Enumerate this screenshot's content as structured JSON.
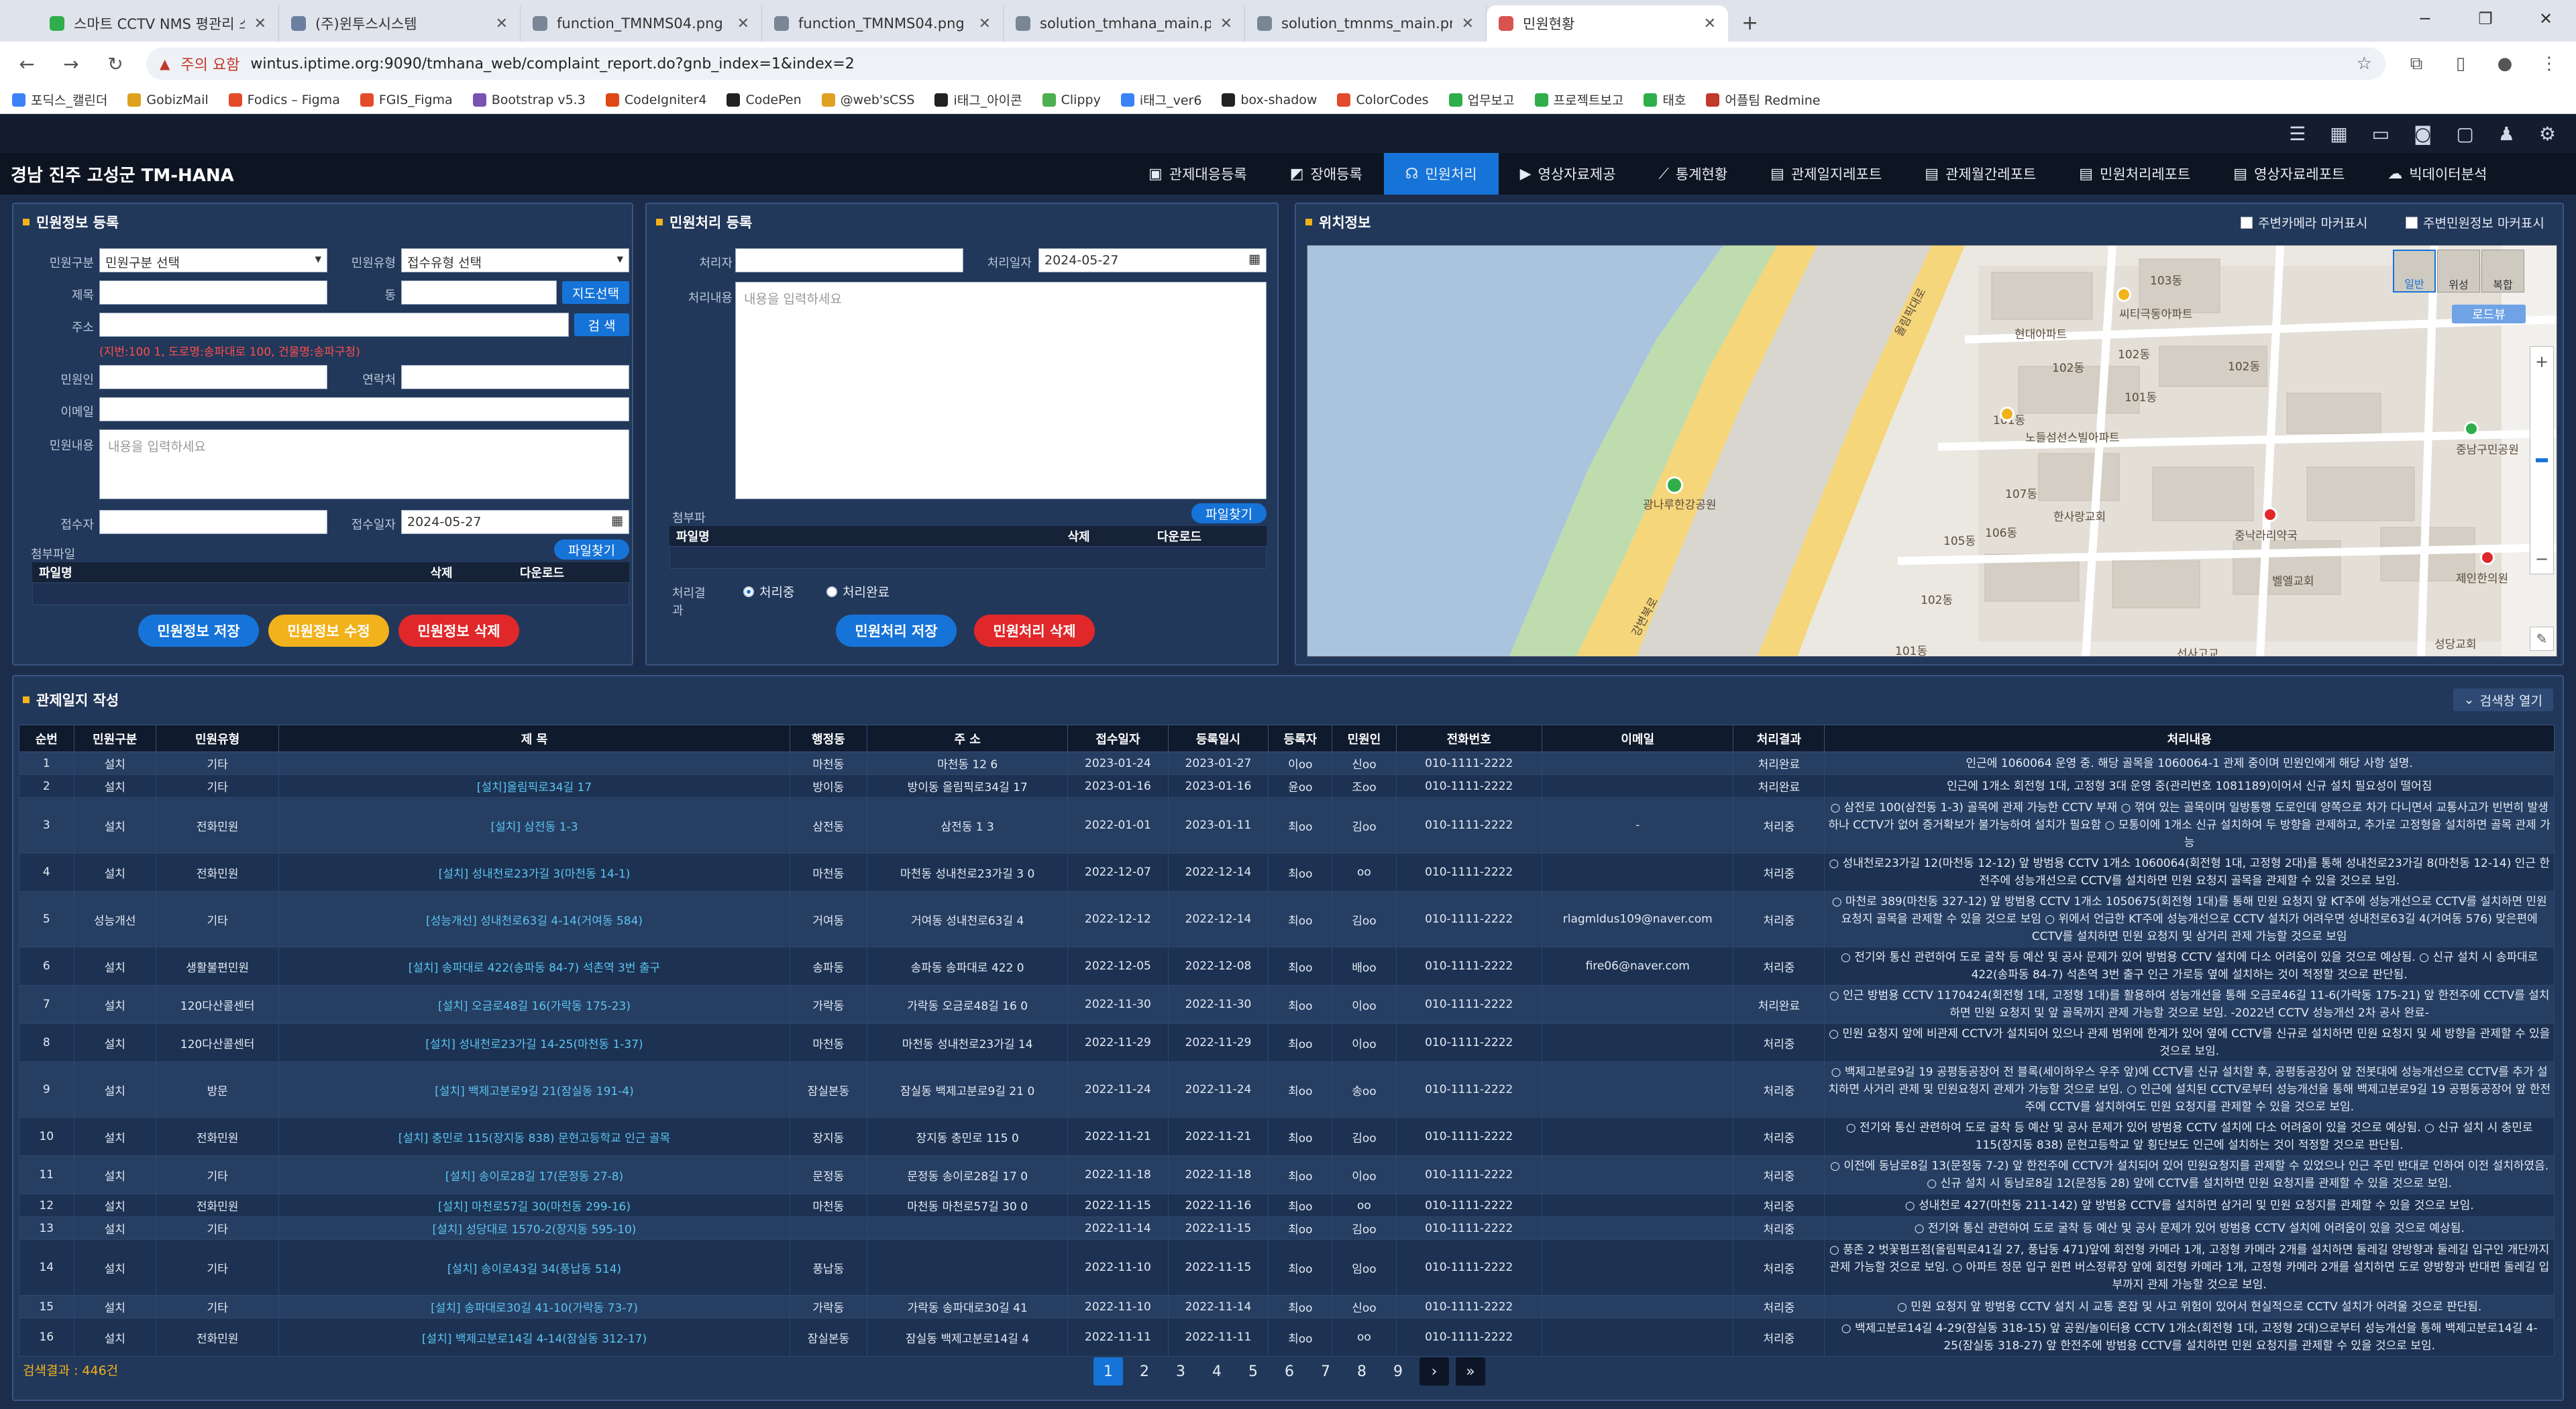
{
  "browser": {
    "tabs": [
      {
        "title": "스마트 CCTV NMS 평관리 소프",
        "color": "#2fae4b"
      },
      {
        "title": "(주)윈투스시스템",
        "color": "#6b7fa0"
      },
      {
        "title": "function_TMNMS04.png (3604",
        "color": "#7a8596"
      },
      {
        "title": "function_TMNMS04.png (3604",
        "color": "#7a8596"
      },
      {
        "title": "solution_tmhana_main.png (7...",
        "color": "#7a8596"
      },
      {
        "title": "solution_tmnms_main.png (72...",
        "color": "#7a8596"
      },
      {
        "title": "민원현황",
        "color": "#d9534f"
      }
    ],
    "security_label": "주의 요함",
    "url": "wintus.iptime.org:9090/tmhana_web/complaint_report.do?gnb_index=1&index=2",
    "bookmarks": [
      {
        "label": "포딕스_캘린더",
        "color": "#3b82f6"
      },
      {
        "label": "GobizMail",
        "color": "#e0a020"
      },
      {
        "label": "Fodics – Figma",
        "color": "#e34b2a"
      },
      {
        "label": "FGIS_Figma",
        "color": "#e34b2a"
      },
      {
        "label": "Bootstrap v5.3",
        "color": "#7952b3"
      },
      {
        "label": "CodeIgniter4",
        "color": "#dd4814"
      },
      {
        "label": "CodePen",
        "color": "#222222"
      },
      {
        "label": "@web'sCSS",
        "color": "#e0a020"
      },
      {
        "label": "i태그_아이콘",
        "color": "#222222"
      },
      {
        "label": "Clippy",
        "color": "#4caf50"
      },
      {
        "label": "i태그_ver6",
        "color": "#3b82f6"
      },
      {
        "label": "box-shadow",
        "color": "#222222"
      },
      {
        "label": "ColorCodes",
        "color": "#e34b2a"
      },
      {
        "label": "업무보고",
        "color": "#2fae4b"
      },
      {
        "label": "프로젝트보고",
        "color": "#2fae4b"
      },
      {
        "label": "태호",
        "color": "#2fae4b"
      },
      {
        "label": "어플팀 Redmine",
        "color": "#c0392b"
      }
    ]
  },
  "app": {
    "title": "경남 진주 고성군 TM-HANA",
    "nav": [
      {
        "label": "관제대응등록",
        "icon": "▣"
      },
      {
        "label": "장애등록",
        "icon": "◩"
      },
      {
        "label": "민원처리",
        "icon": "☊"
      },
      {
        "label": "영상자료제공",
        "icon": "▶"
      },
      {
        "label": "통계현황",
        "icon": "⟋"
      },
      {
        "label": "관제일지레포트",
        "icon": "▤"
      },
      {
        "label": "관제월간레포트",
        "icon": "▤"
      },
      {
        "label": "민원처리레포트",
        "icon": "▤"
      },
      {
        "label": "영상자료레포트",
        "icon": "▤"
      },
      {
        "label": "빅데이터분석",
        "icon": "☁"
      }
    ]
  },
  "complaint_info": {
    "title": "민원정보 등록",
    "type_label": "민원구분",
    "type_value": "민원구분 선택",
    "kind_label": "민원유형",
    "kind_value": "접수유형 선택",
    "subject_label": "제목",
    "dong_label": "동",
    "map_btn": "지도선택",
    "addr_label": "주소",
    "search_btn": "검 색",
    "addr_hint": "(지번:100 1, 도로명:송파대로 100, 건물명:송파구청)",
    "person_label": "민원인",
    "contact_label": "연락처",
    "email_label": "이메일",
    "content_label": "민원내용",
    "content_ph": "내용을 입력하세요",
    "receiver_label": "접수자",
    "date_label": "접수일자",
    "date_value": "2024-05-27",
    "attach_label": "첨부파일",
    "file_btn": "파일찾기",
    "file_cols": [
      "파일명",
      "삭제",
      "다운로드"
    ],
    "save": "민원정보 저장",
    "edit": "민원정보 수정",
    "delete": "민원정보 삭제"
  },
  "complaint_proc": {
    "title": "민원처리 등록",
    "handler_label": "처리자",
    "date_label": "처리일자",
    "date_value": "2024-05-27",
    "content_label": "처리내용",
    "content_ph": "내용을 입력하세요",
    "attach_label": "첨부파일",
    "file_btn": "파일찾기",
    "file_cols": [
      "파일명",
      "삭제",
      "다운로드"
    ],
    "result_label": "처리결과",
    "opt1": "처리중",
    "opt2": "처리완료",
    "save": "민원처리 저장",
    "delete": "민원처리 삭제"
  },
  "location": {
    "title": "위치정보",
    "chk1": "주변카메라 마커표시",
    "chk2": "주변민원정보 마커표시",
    "map_types": [
      "일반",
      "위성",
      "복합"
    ],
    "roadview": "로드뷰",
    "labels": {
      "l1": "올림픽대로",
      "l2": "현대아파트",
      "l3": "씨티극동아파트",
      "l4": "103동",
      "l5": "102동",
      "l6": "101동",
      "l7": "101동",
      "l8": "102동",
      "l9": "102동",
      "l10": "노들섬선스빌아파트",
      "l11": "광나루한강공원",
      "l12": "107동",
      "l13": "106동",
      "l14": "105동",
      "l15": "한사랑교회",
      "l16": "중낙라리약국",
      "l17": "벨엘교회",
      "l18": "제인한의원",
      "l19": "중남구민공원",
      "l20": "102동",
      "l21": "101동",
      "l22": "선사고교",
      "l23": "강변북로",
      "l24": "성당교회"
    }
  },
  "log": {
    "title": "관제일지 작성",
    "search_toggle": "검색창 열기",
    "columns": [
      "순번",
      "민원구분",
      "민원유형",
      "제 목",
      "행정동",
      "주 소",
      "접수일자",
      "등록일시",
      "등록자",
      "민원인",
      "전화번호",
      "이메일",
      "처리결과",
      "처리내용"
    ],
    "rows": [
      [
        "1",
        "설치",
        "기타",
        "",
        "마천동",
        "마천동 12 6",
        "2023-01-24",
        "2023-01-27",
        "이oo",
        "신oo",
        "010-1111-2222",
        "",
        "처리완료",
        "인근에 1060064 운영 중. 해당 골목을 1060064-1 관제 중이며 민원인에게 해당 사항 설명."
      ],
      [
        "2",
        "설치",
        "기타",
        "[설치]올림픽로34길 17",
        "방이동",
        "방이동 올림픽로34길 17",
        "2023-01-16",
        "2023-01-16",
        "윤oo",
        "조oo",
        "010-1111-2222",
        "",
        "처리완료",
        "인근에 1개소 회전형 1대, 고정형 3대 운영 중(관리번호 1081189)이어서 신규 설치 필요성이 떨어짐"
      ],
      [
        "3",
        "설치",
        "전화민원",
        "[설치] 삼전동 1-3",
        "삼전동",
        "삼전동 1 3",
        "2022-01-01",
        "2023-01-11",
        "최oo",
        "김oo",
        "010-1111-2222",
        "-",
        "처리중",
        "○ 삼전로 100(삼전동 1-3) 골목에 관제 가능한 CCTV 부재 ○ 꺾여 있는 골목이며 일방통행 도로인데 양쪽으로 차가 다니면서 교통사고가 빈번히 발생하나 CCTV가 없어 증거확보가 불가능하여 설치가 필요함 ○ 모통이에 1개소 신규 설치하여 두 방향을 관제하고, 추가로 고정형을 설치하면 골목 관제 가능"
      ],
      [
        "4",
        "설치",
        "전화민원",
        "[설치] 성내천로23가길 3(마천동 14-1)",
        "마천동",
        "마천동 성내천로23가길 3 0",
        "2022-12-07",
        "2022-12-14",
        "최oo",
        "oo",
        "010-1111-2222",
        "",
        "처리중",
        "○ 성내천로23가길 12(마천동 12-12) 앞 방범용 CCTV 1개소 1060064(회전형 1대, 고정형 2대)를 통해 성내천로23가길 8(마천동 12-14) 인근 한전주에 성능개선으로 CCTV를 설치하면 민원 요청지 골목을 관제할 수 있을 것으로 보임."
      ],
      [
        "5",
        "성능개선",
        "기타",
        "[성능개선] 성내천로63길 4-14(거여동 584)",
        "거여동",
        "거여동 성내천로63길 4",
        "2022-12-12",
        "2022-12-14",
        "최oo",
        "김oo",
        "010-1111-2222",
        "rlagmldus109@naver.com",
        "처리중",
        "○ 마천로 389(마천동 327-12) 앞 방범용 CCTV 1개소 1050675(회전형 1대)를 통해 민원 요청지 앞 KT주에 성능개선으로 CCTV를 설치하면 민원 요청지 골목을 관제할 수 있을 것으로 보임 ○ 위에서 언급한 KT주에 성능개선으로 CCTV 설치가 어려우면 성내천로63길 4(거여동 576) 맞은편에 CCTV를 설치하면 민원 요청지 및 삼거리 관제 가능할 것으로 보임"
      ],
      [
        "6",
        "설치",
        "생활불편민원",
        "[설치] 송파대로 422(송파동 84-7) 석촌역 3번 출구",
        "송파동",
        "송파동 송파대로 422 0",
        "2022-12-05",
        "2022-12-08",
        "최oo",
        "배oo",
        "010-1111-2222",
        "fire06@naver.com",
        "처리중",
        "○ 전기와 통신 관련하여 도로 굴착 등 예산 및 공사 문제가 있어 방범용 CCTV 설치에 다소 어려움이 있을 것으로 예상됨. ○ 신규 설치 시 송파대로 422(송파동 84-7) 석촌역 3번 출구 인근 가로등 옆에 설치하는 것이 적정할 것으로 판단됨."
      ],
      [
        "7",
        "설치",
        "120다산콜센터",
        "[설치] 오금로48길 16(가락동 175-23)",
        "가락동",
        "가락동 오금로48길 16 0",
        "2022-11-30",
        "2022-11-30",
        "최oo",
        "이oo",
        "010-1111-2222",
        "",
        "처리완료",
        "○ 인근 방범용 CCTV 1170424(회전형 1대, 고정형 1대)를 활용하여 성능개선을 통해 오금로46길 11-6(가락동 175-21) 앞 한전주에 CCTV를 설치하면 민원 요청지 및 앞 골목까지 관제 가능할 것으로 보임. -2022년 CCTV 성능개선 2차 공사 완료-"
      ],
      [
        "8",
        "설치",
        "120다산콜센터",
        "[설치] 성내천로23가길 14-25(마천동 1-37)",
        "마천동",
        "마천동 성내천로23가길 14",
        "2022-11-29",
        "2022-11-29",
        "최oo",
        "이oo",
        "010-1111-2222",
        "",
        "처리중",
        "○ 민원 요청지 앞에 비관제 CCTV가 설치되어 있으나 관제 범위에 한계가 있어 옆에 CCTV를 신규로 설치하면 민원 요청지 및 세 방향을 관제할 수 있을 것으로 보임."
      ],
      [
        "9",
        "설치",
        "방문",
        "[설치] 백제고분로9길 21(잠실동 191-4)",
        "잠실본동",
        "잠실동 백제고분로9길 21 0",
        "2022-11-24",
        "2022-11-24",
        "최oo",
        "송oo",
        "010-1111-2222",
        "",
        "처리중",
        "○ 백제고분로9길 19 공평동공장어 전 블록(세이하우스 우주 앞)에 CCTV를 신규 설치할 후, 공평동공장어 앞 전봇대에 성능개선으로 CCTV를 추가 설치하면 사거리 관제 및 민원요청지 관제가 가능할 것으로 보임. ○ 인근에 설치된 CCTV로부터 성능개선을 통해 백제고분로9길 19 공평동공장어 앞 한전주에 CCTV를 설치하여도 민원 요청지를 관제할 수 있을 것으로 보임."
      ],
      [
        "10",
        "설치",
        "전화민원",
        "[설치] 충민로 115(장지동 838) 문현고등학교 인근 골목",
        "장지동",
        "장지동 충민로 115 0",
        "2022-11-21",
        "2022-11-21",
        "최oo",
        "김oo",
        "010-1111-2222",
        "",
        "처리중",
        "○ 전기와 통신 관련하여 도로 굴착 등 예산 및 공사 문제가 있어 방범용 CCTV 설치에 다소 어려움이 있을 것으로 예상됨. ○ 신규 설치 시 충민로 115(장지동 838) 문현고등학교 앞 횡단보도 인근에 설치하는 것이 적정할 것으로 판단됨."
      ],
      [
        "11",
        "설치",
        "기타",
        "[설치] 송이로28길 17(문정동 27-8)",
        "문정동",
        "문정동 송이로28길 17 0",
        "2022-11-18",
        "2022-11-18",
        "최oo",
        "이oo",
        "010-1111-2222",
        "",
        "처리중",
        "○ 이전에 동남로8길 13(문정동 7-2) 앞 한전주에 CCTV가 설치되어 있어 민원요청지를 관제할 수 있었으나 인근 주민 반대로 인하여 이전 설치하였음. ○ 신규 설치 시 동남로8길 12(문정동 28) 앞에 CCTV를 설치하면 민원 요청지를 관제할 수 있을 것으로 보임."
      ],
      [
        "12",
        "설치",
        "전화민원",
        "[설치] 마천로57길 30(마천동 299-16)",
        "마천동",
        "마천동 마천로57길 30 0",
        "2022-11-15",
        "2022-11-16",
        "최oo",
        "oo",
        "010-1111-2222",
        "",
        "처리중",
        "○ 성내천로 427(마천동 211-142) 앞 방범용 CCTV를 설치하면 삼거리 및 민원 요청지를 관제할 수 있을 것으로 보임."
      ],
      [
        "13",
        "설치",
        "기타",
        "[설치] 성당대로 1570-2(장지동 595-10)",
        "",
        "",
        "2022-11-14",
        "2022-11-15",
        "최oo",
        "김oo",
        "010-1111-2222",
        "",
        "처리중",
        "○ 전기와 통신 관련하여 도로 굴착 등 예산 및 공사 문제가 있어 방범용 CCTV 설치에 어려움이 있을 것으로 예상됨."
      ],
      [
        "14",
        "설치",
        "기타",
        "[설치] 송이로43길 34(풍납동 514)",
        "풍납동",
        "",
        "2022-11-10",
        "2022-11-15",
        "최oo",
        "임oo",
        "010-1111-2222",
        "",
        "처리중",
        "○ 풍존 2 벗꽃펌프점(올림픽로41길 27, 풍납동 471)앞에 회전형 카메라 1개, 고정형 카메라 2개를 설치하면 둘레길 양방향과 둘레길 입구인 개단까지 관제 가능할 것으로 보임. ○ 아파트 정문 입구 원편 버스정류장 앞에 회전형 카메라 1개, 고정형 카메라 2개를 설치하면 도로 양방향과 반대편 둘레길 입부까지 관제 가능할 것으로 보임."
      ],
      [
        "15",
        "설치",
        "기타",
        "[설치] 송파대로30길 41-10(가락동 73-7)",
        "가락동",
        "가락동 송파대로30길 41",
        "2022-11-10",
        "2022-11-14",
        "최oo",
        "신oo",
        "010-1111-2222",
        "",
        "처리중",
        "○ 민원 요청지 앞 방범용 CCTV 설치 시 교통 혼잡 및 사고 위험이 있어서 현실적으로 CCTV 설치가 어려울 것으로 판단됨."
      ],
      [
        "16",
        "설치",
        "전화민원",
        "[설치] 백제고분로14길 4-14(잠실동 312-17)",
        "잠실본동",
        "잠실동 백제고분로14길 4",
        "2022-11-11",
        "2022-11-11",
        "최oo",
        "oo",
        "010-1111-2222",
        "",
        "처리중",
        "○ 백제고분로14길 4-29(잠실동 318-15) 앞 공원/놀이터용 CCTV 1개소(회전형 1대, 고정형 2대)으로부터 성능개선을 통해 백제고분로14길 4-25(잠실동 318-27) 앞 한전주에 방범용 CCTV를 설치하면 민원 요청지를 관제할 수 있을 것으로 보임."
      ]
    ],
    "result_count": "검색결과 : 446건",
    "pages": [
      "1",
      "2",
      "3",
      "4",
      "5",
      "6",
      "7",
      "8",
      "9"
    ]
  }
}
